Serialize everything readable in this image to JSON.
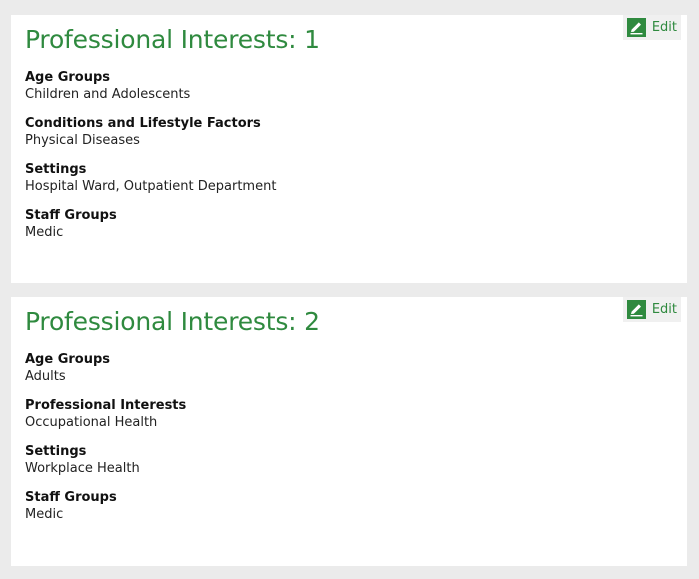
{
  "cards": [
    {
      "title": "Professional Interests: 1",
      "edit_label": "Edit",
      "fields": [
        {
          "label": "Age Groups",
          "value": "Children and Adolescents"
        },
        {
          "label": "Conditions and Lifestyle Factors",
          "value": "Physical Diseases"
        },
        {
          "label": "Settings",
          "value": "Hospital Ward, Outpatient Department"
        },
        {
          "label": "Staff Groups",
          "value": "Medic"
        }
      ]
    },
    {
      "title": "Professional Interests: 2",
      "edit_label": "Edit",
      "fields": [
        {
          "label": "Age Groups",
          "value": "Adults"
        },
        {
          "label": "Professional Interests",
          "value": "Occupational Health"
        },
        {
          "label": "Settings",
          "value": "Workplace Health"
        },
        {
          "label": "Staff Groups",
          "value": "Medic"
        }
      ]
    }
  ],
  "icons": {
    "edit": "pencil-icon"
  },
  "colors": {
    "accent": "#2f8a3f",
    "background": "#ebebeb",
    "card": "#ffffff"
  }
}
